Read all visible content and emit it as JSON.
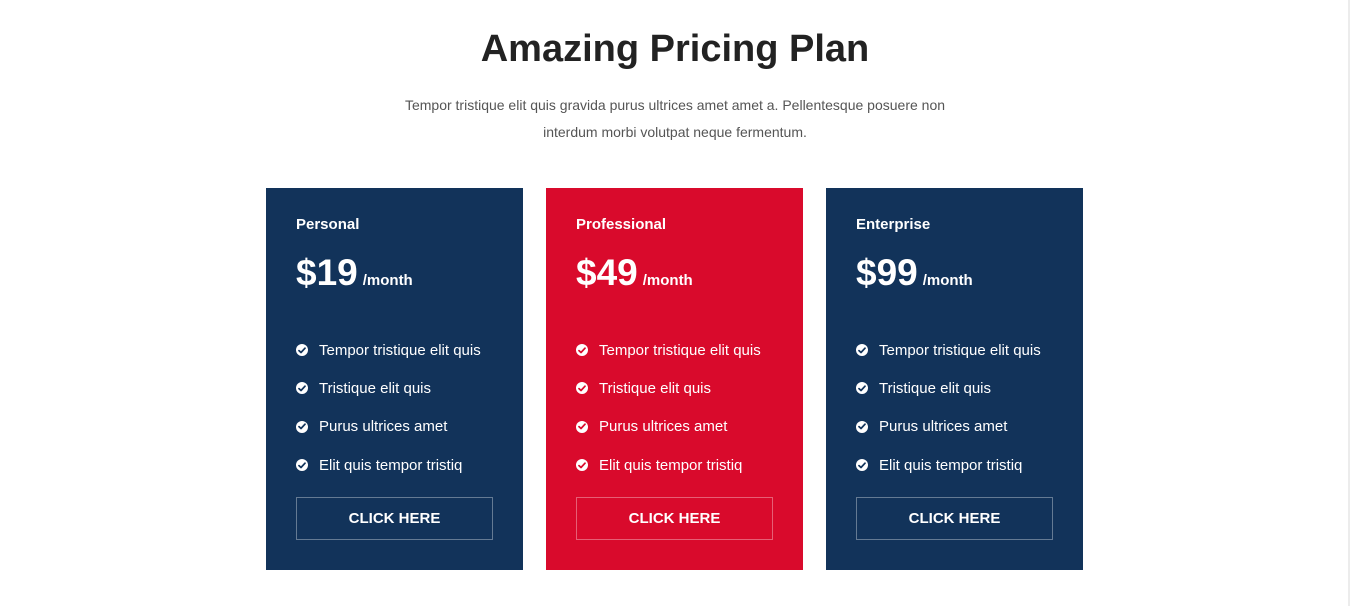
{
  "section": {
    "title": "Amazing Pricing Plan",
    "subtitle": "Tempor tristique elit quis gravida purus ultrices amet amet a. Pellentesque posuere non interdum morbi volutpat neque fermentum."
  },
  "colors": {
    "navy": "#12335a",
    "red": "#d90a2c"
  },
  "plans": [
    {
      "name": "Personal",
      "price": "$19",
      "period": "/month",
      "color": "#12335a",
      "features": [
        "Tempor tristique elit quis",
        "Tristique elit quis",
        "Purus ultrices amet",
        "Elit quis tempor tristiq"
      ],
      "button": "CLICK HERE",
      "icon": "check-circle-icon"
    },
    {
      "name": "Professional",
      "price": "$49",
      "period": "/month",
      "color": "#d90a2c",
      "features": [
        "Tempor tristique elit quis",
        "Tristique elit quis",
        "Purus ultrices amet",
        "Elit quis tempor tristiq"
      ],
      "button": "CLICK HERE",
      "icon": "check-circle-icon"
    },
    {
      "name": "Enterprise",
      "price": "$99",
      "period": "/month",
      "color": "#12335a",
      "features": [
        "Tempor tristique elit quis",
        "Tristique elit quis",
        "Purus ultrices amet",
        "Elit quis tempor tristiq"
      ],
      "button": "CLICK HERE",
      "icon": "check-circle-icon"
    }
  ]
}
